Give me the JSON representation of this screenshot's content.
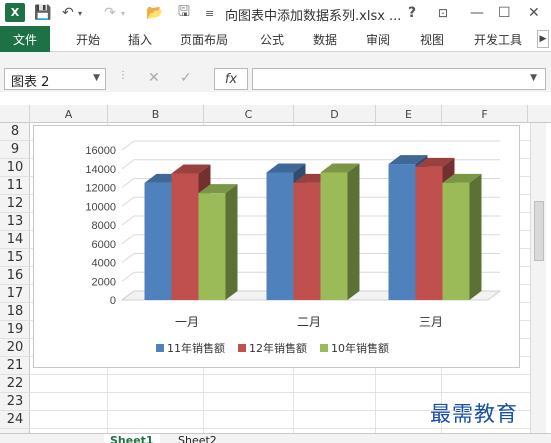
{
  "titlebar": {
    "logo": "X",
    "title": "向图表中添加数据系列.xlsx ...",
    "help": "?",
    "minimize": "—",
    "maximize": "☐",
    "close": "✕"
  },
  "ribbon": {
    "file": "文件",
    "tabs": [
      "开始",
      "插入",
      "页面布局",
      "公式",
      "数据",
      "审阅",
      "视图",
      "开发工具"
    ]
  },
  "formula_bar": {
    "name_box": "图表 2",
    "fx": "fx",
    "value": ""
  },
  "columns": [
    "A",
    "B",
    "C",
    "D",
    "E",
    "F"
  ],
  "rows": [
    "8",
    "9",
    "10",
    "11",
    "12",
    "13",
    "14",
    "15",
    "16",
    "17",
    "18",
    "19",
    "20",
    "21",
    "22",
    "23",
    "24"
  ],
  "chart_data": {
    "type": "bar",
    "categories": [
      "一月",
      "二月",
      "三月"
    ],
    "series": [
      {
        "name": "11年销售额",
        "color": "#4f81bd",
        "values": [
          12500,
          13600,
          14500
        ]
      },
      {
        "name": "12年销售额",
        "color": "#c0504d",
        "values": [
          13500,
          12500,
          14200
        ]
      },
      {
        "name": "10年销售额",
        "color": "#9bbb59",
        "values": [
          11400,
          13600,
          12500
        ]
      }
    ],
    "ylim": [
      0,
      16000
    ],
    "yticks": [
      "16000",
      "14000",
      "12000",
      "10000",
      "8000",
      "6000",
      "4000",
      "2000",
      "0"
    ],
    "legend": "bottom",
    "grid": true
  },
  "sheets": [
    "Sheet1",
    "Sheet2"
  ],
  "watermark": "最需教育"
}
